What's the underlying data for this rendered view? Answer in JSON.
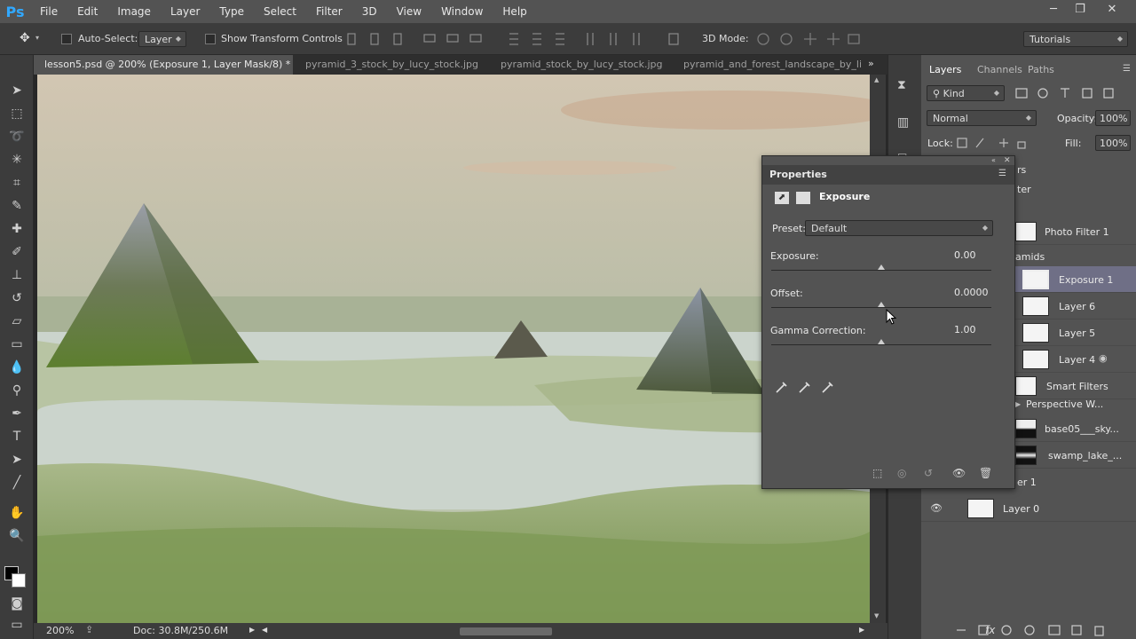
{
  "app": {
    "logo": "Ps"
  },
  "menu": [
    "File",
    "Edit",
    "Image",
    "Layer",
    "Type",
    "Select",
    "Filter",
    "3D",
    "View",
    "Window",
    "Help"
  ],
  "window_controls": {
    "minimize": "─",
    "maximize": "❐",
    "close": "✕"
  },
  "options": {
    "auto_select_label": "Auto-Select:",
    "auto_select_value": "Layer",
    "transform_label": "Show Transform Controls",
    "mode_label": "3D Mode:",
    "workspace": "Tutorials"
  },
  "tabs": [
    {
      "label": "lesson5.psd @ 200% (Exposure 1, Layer Mask/8) *",
      "close": "✕"
    },
    {
      "label": "pyramid_3_stock_by_lucy_stock.jpg",
      "close": "✕"
    },
    {
      "label": "pyramid_stock_by_lucy_stock.jpg",
      "close": "✕"
    },
    {
      "label": "pyramid_and_forest_landscape_by_li",
      "close": ""
    }
  ],
  "tabs_overflow": "»",
  "status": {
    "zoom": "200%",
    "doc": "Doc: 30.8M/250.6M"
  },
  "layers_panel": {
    "tabs": [
      "Layers",
      "Channels",
      "Paths"
    ],
    "kind": "Kind",
    "blend_mode": "Normal",
    "opacity_label": "Opacity:",
    "opacity_value": "100%",
    "lock_label": "Lock:",
    "fill_label": "Fill:",
    "fill_value": "100%",
    "partial_1": "rs",
    "partial_2": "ter",
    "group_partial": "amids",
    "layer_1_partial": "er 1",
    "layers": [
      "Photo Filter 1",
      "Exposure 1",
      "Layer 6",
      "Layer 5",
      "Layer 4",
      "Smart Filters",
      "Perspective W...",
      "base05___sky...",
      "swamp_lake_...",
      "Layer 0"
    ]
  },
  "properties": {
    "title": "Properties",
    "heading": "Exposure",
    "preset_label": "Preset:",
    "preset_value": "Default",
    "exposure_label": "Exposure:",
    "exposure_value": "0.00",
    "exposure_level": 0.5,
    "offset_label": "Offset:",
    "offset_value": "0.0000",
    "offset_level": 0.5,
    "gamma_label": "Gamma Correction:",
    "gamma_value": "1.00",
    "gamma_level": 0.5
  }
}
